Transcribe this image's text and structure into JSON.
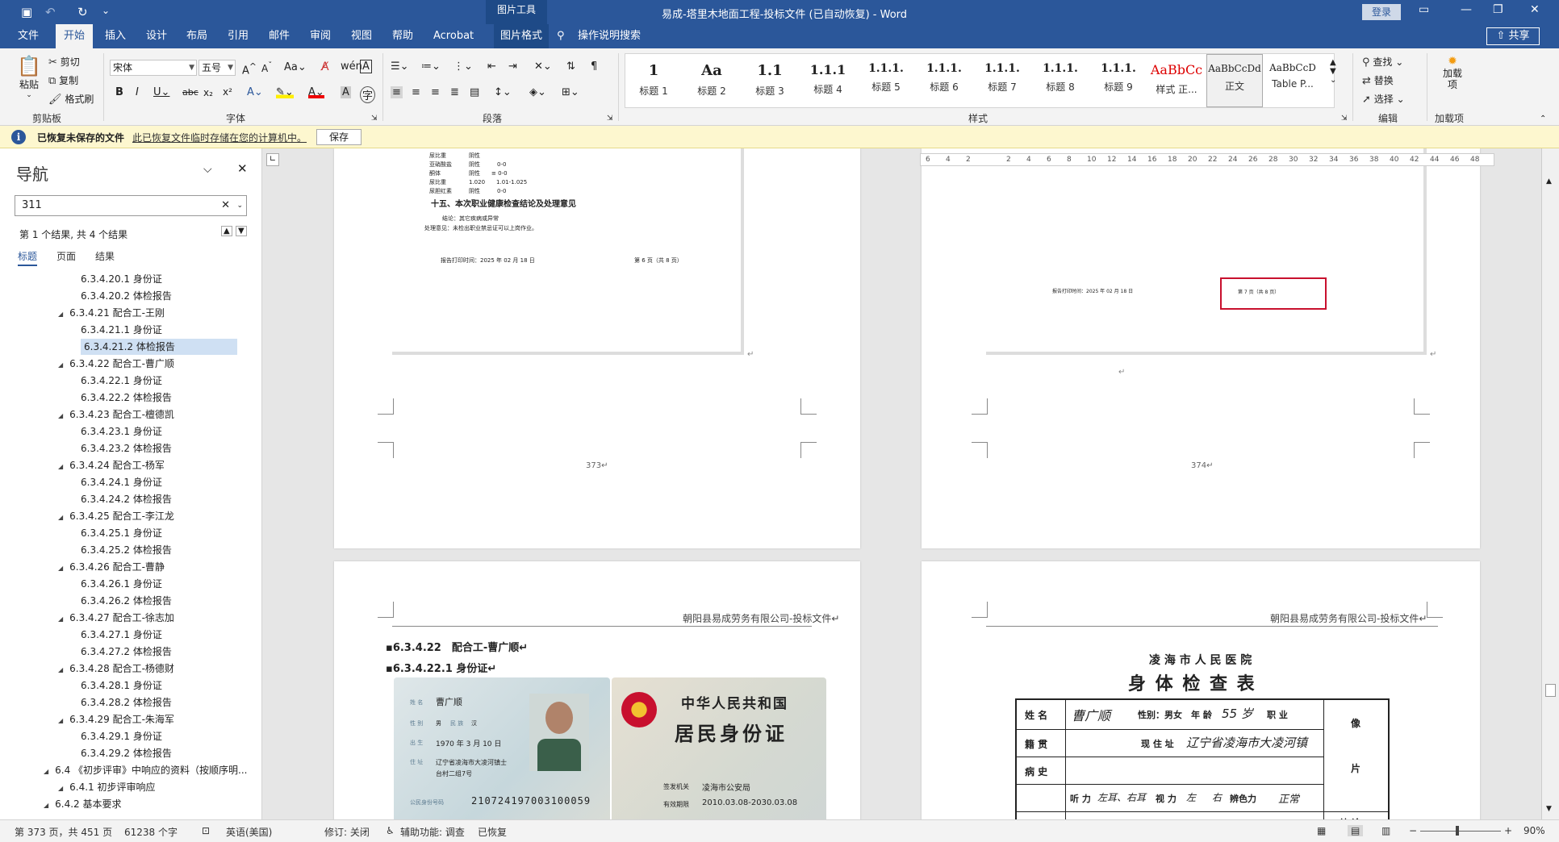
{
  "titlebar": {
    "doc_title": "易成-塔里木地面工程-投标文件 (已自动恢复)  -  Word",
    "context_tab_title": "图片工具",
    "login": "登录",
    "qa_save": "▣",
    "qa_undo": "↶",
    "qa_redo": "↻",
    "qa_more": "⌄"
  },
  "ribbon_tabs": [
    "文件",
    "开始",
    "插入",
    "设计",
    "布局",
    "引用",
    "邮件",
    "审阅",
    "视图",
    "帮助",
    "Acrobat",
    "图片格式"
  ],
  "ribbon": {
    "tell_me": "操作说明搜索",
    "share": "共享",
    "clipboard": {
      "paste": "粘贴",
      "cut": "剪切",
      "copy": "复制",
      "format_painter": "格式刷",
      "label": "剪贴板"
    },
    "font": {
      "name": "宋体",
      "size": "五号",
      "label": "字体"
    },
    "paragraph": {
      "label": "段落"
    },
    "styles": {
      "label": "样式",
      "items": [
        {
          "sample": "1",
          "name": "标题 1"
        },
        {
          "sample": "Aa",
          "name": "标题 2"
        },
        {
          "sample": "1.1",
          "name": "标题 3"
        },
        {
          "sample": "1.1.1",
          "name": "标题 4"
        },
        {
          "sample": "1.1.1.",
          "name": "标题 5"
        },
        {
          "sample": "1.1.1.",
          "name": "标题 6"
        },
        {
          "sample": "1.1.1.",
          "name": "标题 7"
        },
        {
          "sample": "1.1.1.",
          "name": "标题 8"
        },
        {
          "sample": "1.1.1.",
          "name": "标题 9"
        },
        {
          "sample": "AaBbCc",
          "name": "样式 正..."
        },
        {
          "sample": "AaBbCcDd",
          "name": "正文"
        },
        {
          "sample": "AaBbCcD",
          "name": "Table P..."
        }
      ]
    },
    "editing": {
      "find": "查找",
      "replace": "替换",
      "select": "选择",
      "label": "编辑"
    },
    "addins": {
      "btn": "加载项",
      "label": "加载项"
    }
  },
  "messagebar": {
    "title": "已恢复未保存的文件",
    "link": "此已恢复文件临时存储在您的计算机中。",
    "save": "保存"
  },
  "nav": {
    "title": "导航",
    "search_value": "311",
    "result_text": "第 1 个结果, 共 4 个结果",
    "tabs": [
      "标题",
      "页面",
      "结果"
    ],
    "items": [
      {
        "text": "6.3.4.20.1 身份证",
        "level": 2
      },
      {
        "text": "6.3.4.20.2 体检报告",
        "level": 2
      },
      {
        "text": "6.3.4.21 配合工-王刚",
        "level": 1
      },
      {
        "text": "6.3.4.21.1 身份证",
        "level": 2
      },
      {
        "text": "6.3.4.21.2 体检报告",
        "level": 2,
        "selected": true
      },
      {
        "text": "6.3.4.22 配合工-曹广顺",
        "level": 1
      },
      {
        "text": "6.3.4.22.1 身份证",
        "level": 2
      },
      {
        "text": "6.3.4.22.2 体检报告",
        "level": 2
      },
      {
        "text": "6.3.4.23 配合工-檀德凯",
        "level": 1
      },
      {
        "text": "6.3.4.23.1 身份证",
        "level": 2
      },
      {
        "text": "6.3.4.23.2 体检报告",
        "level": 2
      },
      {
        "text": "6.3.4.24 配合工-杨军",
        "level": 1
      },
      {
        "text": "6.3.4.24.1 身份证",
        "level": 2
      },
      {
        "text": "6.3.4.24.2 体检报告",
        "level": 2
      },
      {
        "text": "6.3.4.25 配合工-李江龙",
        "level": 1
      },
      {
        "text": "6.3.4.25.1 身份证",
        "level": 2
      },
      {
        "text": "6.3.4.25.2 体检报告",
        "level": 2
      },
      {
        "text": "6.3.4.26 配合工-曹静",
        "level": 1
      },
      {
        "text": "6.3.4.26.1 身份证",
        "level": 2
      },
      {
        "text": "6.3.4.26.2 体检报告",
        "level": 2
      },
      {
        "text": "6.3.4.27 配合工-徐志加",
        "level": 1
      },
      {
        "text": "6.3.4.27.1 身份证",
        "level": 2
      },
      {
        "text": "6.3.4.27.2 体检报告",
        "level": 2
      },
      {
        "text": "6.3.4.28 配合工-杨德财",
        "level": 1
      },
      {
        "text": "6.3.4.28.1 身份证",
        "level": 2
      },
      {
        "text": "6.3.4.28.2 体检报告",
        "level": 2
      },
      {
        "text": "6.3.4.29 配合工-朱海军",
        "level": 1
      },
      {
        "text": "6.3.4.29.1 身份证",
        "level": 2
      },
      {
        "text": "6.3.4.29.2 体检报告",
        "level": 2
      },
      {
        "text": "6.4 《初步评审》中响应的资料（按顺序明...",
        "level": 0
      },
      {
        "text": "6.4.1 初步评审响应",
        "level": 1
      },
      {
        "text": "6.4.2 基本要求",
        "level": 0
      }
    ]
  },
  "doc": {
    "page373": {
      "heading15": "十五、本次职业健康检查结论及处理意见",
      "conclusion": "结论：其它疾病或异常",
      "advice": "处理意见：未检出职业禁忌证可以上岗作业。",
      "print_time": "报告打印时间：2025 年 02 月 18 日",
      "page_of": "第 6 页（共 8 页）",
      "page_num": "373↵"
    },
    "page374": {
      "print_time": "报告打印时间：2025 年 02 月 18 日",
      "page_of": "第 7 页（共 8 页）",
      "page_num": "374↵"
    },
    "page375": {
      "header": "朝阳县易成劳务有限公司-投标文件↵",
      "h1": "6.3.4.22　配合工-曹广顺↵",
      "h2": "6.3.4.22.1 身份证↵",
      "id_name": "曹广顺",
      "id_sex": "男",
      "id_nation": "汉",
      "id_birth": "1970 年 3 月 10 日",
      "id_addr1": "辽宁省凌海市大凌河镇士",
      "id_addr2": "台村二组7号",
      "id_number": "210724197003100059",
      "id_country": "中华人民共和国",
      "id_card": "居民身份证",
      "id_authority": "凌海市公安局",
      "id_valid": "2010.03.08-2030.03.08",
      "lbl_name": "姓 名",
      "lbl_sex": "性 别",
      "lbl_nation": "民 族",
      "lbl_birth": "出 生",
      "lbl_addr": "住 址",
      "lbl_idno": "公民身份号码",
      "lbl_authority": "签发机关",
      "lbl_valid": "有效期限"
    },
    "page376": {
      "header": "朝阳县易成劳务有限公司-投标文件↵",
      "hospital": "凌 海 市 人 民 医 院",
      "form_title": "身 体 检 查 表",
      "cells": [
        "姓 名",
        "曹广顺",
        "性别：男女",
        "年 龄",
        "55 岁",
        "职 业",
        "籍 贯",
        "现 住 址",
        "辽宁省凌海市大凌河镇",
        "病 史",
        "听 力",
        "左耳、右耳",
        "视 力",
        "左",
        "右",
        "辨色力",
        "正常"
      ],
      "photo": "像",
      "photo2": "片",
      "conclusion": "结 论"
    }
  },
  "ruler": [
    "6",
    "4",
    "2",
    "",
    "2",
    "4",
    "6",
    "8",
    "10",
    "12",
    "14",
    "16",
    "18",
    "20",
    "22",
    "24",
    "26",
    "28",
    "30",
    "32",
    "34",
    "36",
    "38",
    "40",
    "42",
    "44",
    "46",
    "48"
  ],
  "status": {
    "page": "第 373 页，共 451 页",
    "words": "61238 个字",
    "lang": "英语(美国)",
    "track": "修订: 关闭",
    "access": "辅助功能: 调查",
    "recovered": "已恢复",
    "zoom": "90%"
  }
}
